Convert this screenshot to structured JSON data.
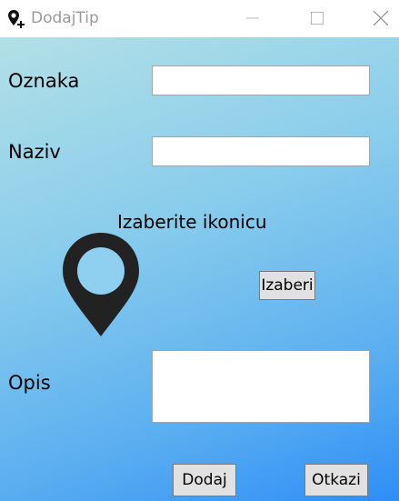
{
  "window": {
    "title": "DodajTip"
  },
  "titlebar_buttons": {
    "minimize_icon": "minimize-icon",
    "maximize_icon": "maximize-icon",
    "close_icon": "close-icon"
  },
  "form": {
    "oznaka_label": "Oznaka",
    "oznaka_value": "",
    "naziv_label": "Naziv",
    "naziv_value": "",
    "icon_heading": "Izaberite ikonicu",
    "choose_button": "Izaberi",
    "opis_label": "Opis",
    "opis_value": "",
    "add_button": "Dodaj",
    "cancel_button": "Otkazi"
  },
  "icons": {
    "app": "map-pin-add-icon",
    "preview": "map-pin-icon"
  },
  "colors": {
    "gradient_top": "#b2e0e6",
    "gradient_bottom": "#2e8ef6",
    "pin": "#222222"
  }
}
